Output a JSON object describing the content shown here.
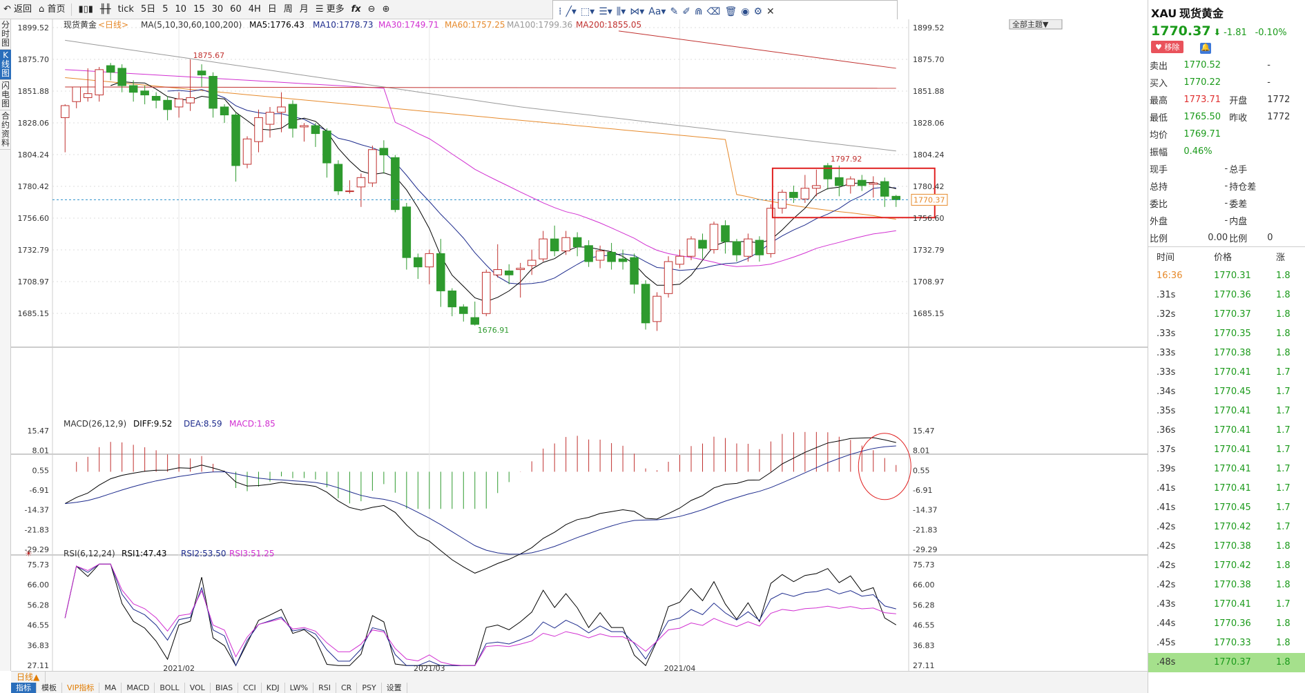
{
  "toolbar": {
    "back": "返回",
    "home": "首页",
    "periods": [
      "tick",
      "5日",
      "5",
      "10",
      "15",
      "30",
      "60",
      "4H",
      "日",
      "周",
      "月"
    ],
    "more": "更多",
    "fx": "fx"
  },
  "left_tabs": [
    "分时图",
    "K线图",
    "闪电图",
    "合约资料"
  ],
  "chart_header": {
    "name": "现货黄金",
    "period": "<日线>",
    "ma_label": "MA(5,10,30,60,100,200)",
    "ma5": "MA5:1776.43",
    "ma10": "MA10:1778.73",
    "ma30": "MA30:1749.71",
    "ma60": "MA60:1757.25",
    "ma100": "MA100:1799.36",
    "ma200": "MA200:1855.05",
    "theme_btn": "全部主题▼"
  },
  "colors": {
    "up": "#c0302e",
    "down": "#2e9a2e",
    "ma5": "#000000",
    "ma10": "#1c2a8c",
    "ma30": "#d12fd1",
    "ma60": "#e6892a",
    "ma100": "#999999",
    "ma200": "#c0302e",
    "rsi1": "#000000",
    "rsi2": "#1c2a8c",
    "rsi3": "#d12fd1"
  },
  "chart_data": {
    "type": "candlestick",
    "y_ticks": [
      1899.52,
      1875.7,
      1851.88,
      1828.06,
      1804.24,
      1780.42,
      1756.6,
      1732.79,
      1708.97,
      1685.15
    ],
    "x_labels": [
      "2021/02",
      "2021/03",
      "2021/04"
    ],
    "annotations": {
      "high": "1875.67",
      "low": "1676.91",
      "recent_high": "1797.92",
      "last": "1770.37"
    },
    "candles": [
      [
        1832,
        1841,
        1806,
        1842
      ],
      [
        1844,
        1855,
        1839,
        1850
      ],
      [
        1847,
        1850,
        1844,
        1869
      ],
      [
        1849,
        1868,
        1844,
        1870
      ],
      [
        1871,
        1866,
        1860,
        1873
      ],
      [
        1869,
        1856,
        1851,
        1872
      ],
      [
        1856,
        1851,
        1844,
        1860
      ],
      [
        1852,
        1849,
        1842,
        1856
      ],
      [
        1848,
        1845,
        1839,
        1851
      ],
      [
        1845,
        1838,
        1830,
        1848
      ],
      [
        1840,
        1846,
        1832,
        1851
      ],
      [
        1843,
        1847,
        1837,
        1875.67
      ],
      [
        1867,
        1864,
        1855,
        1872
      ],
      [
        1863,
        1839,
        1832,
        1866
      ],
      [
        1840,
        1834,
        1828,
        1842
      ],
      [
        1834,
        1796,
        1784,
        1836
      ],
      [
        1797,
        1816,
        1794,
        1818
      ],
      [
        1814,
        1832,
        1806,
        1838
      ],
      [
        1827,
        1836,
        1817,
        1840
      ],
      [
        1836,
        1840,
        1821,
        1851
      ],
      [
        1842,
        1824,
        1817,
        1845
      ],
      [
        1825,
        1826,
        1814,
        1828
      ],
      [
        1826,
        1820,
        1810,
        1828
      ],
      [
        1822,
        1798,
        1787,
        1824
      ],
      [
        1797,
        1777,
        1774,
        1800
      ],
      [
        1777,
        1777,
        1775,
        1785
      ],
      [
        1780,
        1787,
        1765,
        1790
      ],
      [
        1783,
        1808,
        1780,
        1811
      ],
      [
        1809,
        1804,
        1790,
        1815
      ],
      [
        1802,
        1763,
        1761,
        1804
      ],
      [
        1765,
        1727,
        1718,
        1768
      ],
      [
        1727,
        1720,
        1711,
        1730
      ],
      [
        1720,
        1730,
        1707,
        1733
      ],
      [
        1730,
        1702,
        1690,
        1741
      ],
      [
        1702,
        1690,
        1683,
        1704
      ],
      [
        1690,
        1685,
        1679,
        1692
      ],
      [
        1682,
        1676.91,
        1676,
        1694
      ],
      [
        1685,
        1716,
        1683,
        1718
      ],
      [
        1714,
        1718,
        1712,
        1737
      ],
      [
        1717,
        1714,
        1707,
        1722
      ],
      [
        1718,
        1719,
        1697,
        1723
      ],
      [
        1721,
        1725,
        1714,
        1733
      ],
      [
        1726,
        1741,
        1724,
        1747
      ],
      [
        1741,
        1732,
        1728,
        1751
      ],
      [
        1732,
        1742,
        1729,
        1747
      ],
      [
        1742,
        1735,
        1728,
        1746
      ],
      [
        1736,
        1724,
        1720,
        1740
      ],
      [
        1725,
        1732,
        1719,
        1736
      ],
      [
        1731,
        1724,
        1718,
        1738
      ],
      [
        1726,
        1724,
        1718,
        1733
      ],
      [
        1727,
        1707,
        1700,
        1730
      ],
      [
        1707,
        1678,
        1673,
        1710
      ],
      [
        1679,
        1698,
        1672,
        1701
      ],
      [
        1700,
        1724,
        1697,
        1728
      ],
      [
        1722,
        1728,
        1719,
        1733
      ],
      [
        1728,
        1741,
        1725,
        1743
      ],
      [
        1740,
        1734,
        1726,
        1745
      ],
      [
        1733,
        1752,
        1730,
        1754
      ],
      [
        1751,
        1739,
        1730,
        1755
      ],
      [
        1739,
        1729,
        1724,
        1741
      ],
      [
        1728,
        1741,
        1724,
        1745
      ],
      [
        1740,
        1729,
        1724,
        1743
      ],
      [
        1730,
        1764,
        1727,
        1767
      ],
      [
        1764,
        1776,
        1760,
        1778
      ],
      [
        1776,
        1772,
        1768,
        1781
      ],
      [
        1771,
        1779,
        1768,
        1789
      ],
      [
        1779,
        1781,
        1773,
        1793
      ],
      [
        1796,
        1786,
        1778,
        1797.92
      ],
      [
        1787,
        1781,
        1773,
        1796
      ],
      [
        1781,
        1786,
        1775,
        1788
      ],
      [
        1785,
        1781,
        1777,
        1789
      ],
      [
        1782,
        1783,
        1772,
        1788
      ],
      [
        1784,
        1773,
        1765,
        1787
      ],
      [
        1773,
        1770.37,
        1765,
        1774
      ]
    ],
    "macd": {
      "label": "MACD(26,12,9)",
      "diff": "DIFF:9.52",
      "dea": "DEA:8.59",
      "macd": "MACD:1.85",
      "y_ticks": [
        15.47,
        8.01,
        0.55,
        -6.91,
        -14.37,
        -21.83,
        -29.29
      ]
    },
    "rsi": {
      "label": "RSI(6,12,24)",
      "rsi1": "RSI1:47.43",
      "rsi2": "RSI2:53.50",
      "rsi3": "RSI3:51.25",
      "y_ticks": [
        75.73,
        66.0,
        56.28,
        46.55,
        36.83,
        27.11
      ]
    }
  },
  "quote": {
    "symbol": "XAU",
    "name": "现货黄金",
    "price": "1770.37",
    "arrow": "⬇",
    "change": "-1.81",
    "pct": "-0.10%",
    "remove": "♥ 移除",
    "rows": [
      {
        "k1": "卖出",
        "v1": "1770.52",
        "k2": "",
        "v2": "-"
      },
      {
        "k1": "买入",
        "v1": "1770.22",
        "k2": "",
        "v2": "-"
      },
      {
        "k1": "最高",
        "v1": "1773.71",
        "k2": "开盘",
        "v2": "1772"
      },
      {
        "k1": "最低",
        "v1": "1765.50",
        "k2": "昨收",
        "v2": "1772"
      },
      {
        "k1": "均价",
        "v1": "1769.71",
        "k2": "",
        "v2": ""
      },
      {
        "k1": "振幅",
        "v1": "0.46%",
        "k2": "",
        "v2": ""
      },
      {
        "k1": "现手",
        "v1": "-",
        "k2": "总手",
        "v2": ""
      },
      {
        "k1": "总持",
        "v1": "-",
        "k2": "持仓差",
        "v2": ""
      },
      {
        "k1": "委比",
        "v1": "-",
        "k2": "委差",
        "v2": ""
      },
      {
        "k1": "外盘",
        "v1": "-",
        "k2": "内盘",
        "v2": ""
      },
      {
        "k1": "比例",
        "v1": "0.00",
        "k2": "比例",
        "v2": "0"
      }
    ],
    "tick_headers": [
      "时间",
      "价格",
      "涨"
    ],
    "ticks": [
      {
        "t": "16:36",
        "p": "1770.31",
        "c": "1.8"
      },
      {
        "t": ".31s",
        "p": "1770.36",
        "c": "1.8"
      },
      {
        "t": ".32s",
        "p": "1770.37",
        "c": "1.8"
      },
      {
        "t": ".33s",
        "p": "1770.35",
        "c": "1.8"
      },
      {
        "t": ".33s",
        "p": "1770.38",
        "c": "1.8"
      },
      {
        "t": ".33s",
        "p": "1770.41",
        "c": "1.7"
      },
      {
        "t": ".34s",
        "p": "1770.45",
        "c": "1.7"
      },
      {
        "t": ".35s",
        "p": "1770.41",
        "c": "1.7"
      },
      {
        "t": ".36s",
        "p": "1770.41",
        "c": "1.7"
      },
      {
        "t": ".37s",
        "p": "1770.41",
        "c": "1.7"
      },
      {
        "t": ".39s",
        "p": "1770.41",
        "c": "1.7"
      },
      {
        "t": ".41s",
        "p": "1770.41",
        "c": "1.7"
      },
      {
        "t": ".41s",
        "p": "1770.45",
        "c": "1.7"
      },
      {
        "t": ".42s",
        "p": "1770.42",
        "c": "1.7"
      },
      {
        "t": ".42s",
        "p": "1770.38",
        "c": "1.8"
      },
      {
        "t": ".42s",
        "p": "1770.42",
        "c": "1.8"
      },
      {
        "t": ".42s",
        "p": "1770.38",
        "c": "1.8"
      },
      {
        "t": ".43s",
        "p": "1770.41",
        "c": "1.7"
      },
      {
        "t": ".44s",
        "p": "1770.36",
        "c": "1.8"
      },
      {
        "t": ".45s",
        "p": "1770.33",
        "c": "1.8"
      },
      {
        "t": ".48s",
        "p": "1770.37",
        "c": "1.8"
      }
    ]
  },
  "bottom": {
    "period_tab": "日线▲",
    "ind_tabs": [
      "指标",
      "模板",
      "VIP指标",
      "MA",
      "MACD",
      "BOLL",
      "VOL",
      "BIAS",
      "CCI",
      "KDJ",
      "LW%",
      "RSI",
      "CR",
      "PSY",
      "设置"
    ]
  }
}
